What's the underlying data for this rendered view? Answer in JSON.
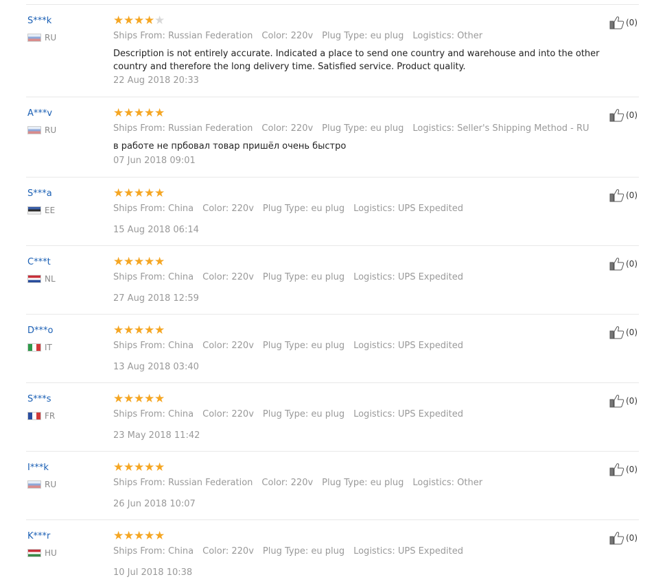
{
  "colors": {
    "star_on": "#f5a623",
    "star_off": "#d8d8d8",
    "user_link": "#1a5fb4"
  },
  "labels": {
    "ships_from": "Ships From:",
    "color": "Color:",
    "plug_type": "Plug Type:",
    "logistics": "Logistics:"
  },
  "reviews": [
    {
      "user": "S***k",
      "country": "RU",
      "flag": "ru",
      "rating": 4,
      "ships_from": "Russian Federation",
      "color": "220v",
      "plug": "eu plug",
      "logistics": "Other",
      "description": "Description is not entirely accurate. Indicated a place to send one country and warehouse and into the other country and therefore the long delivery time. Satisfied service. Product quality.",
      "date": "22 Aug 2018 20:33",
      "helpful": "(0)"
    },
    {
      "user": "A***v",
      "country": "RU",
      "flag": "ru",
      "rating": 5,
      "ships_from": "Russian Federation",
      "color": "220v",
      "plug": "eu plug",
      "logistics": "Seller's Shipping Method - RU",
      "description": "в работе не прбовал товар пришёл очень быстро",
      "date": "07 Jun 2018 09:01",
      "helpful": "(0)"
    },
    {
      "user": "S***a",
      "country": "EE",
      "flag": "ee",
      "rating": 5,
      "ships_from": "China",
      "color": "220v",
      "plug": "eu plug",
      "logistics": "UPS Expedited",
      "description": "",
      "date": "15 Aug 2018 06:14",
      "helpful": "(0)"
    },
    {
      "user": "C***t",
      "country": "NL",
      "flag": "nl",
      "rating": 5,
      "ships_from": "China",
      "color": "220v",
      "plug": "eu plug",
      "logistics": "UPS Expedited",
      "description": "",
      "date": "27 Aug 2018 12:59",
      "helpful": "(0)"
    },
    {
      "user": "D***o",
      "country": "IT",
      "flag": "it",
      "rating": 5,
      "ships_from": "China",
      "color": "220v",
      "plug": "eu plug",
      "logistics": "UPS Expedited",
      "description": "",
      "date": "13 Aug 2018 03:40",
      "helpful": "(0)"
    },
    {
      "user": "S***s",
      "country": "FR",
      "flag": "fr",
      "rating": 5,
      "ships_from": "China",
      "color": "220v",
      "plug": "eu plug",
      "logistics": "UPS Expedited",
      "description": "",
      "date": "23 May 2018 11:42",
      "helpful": "(0)"
    },
    {
      "user": "I***k",
      "country": "RU",
      "flag": "ru",
      "rating": 5,
      "ships_from": "Russian Federation",
      "color": "220v",
      "plug": "eu plug",
      "logistics": "Other",
      "description": "",
      "date": "26 Jun 2018 10:07",
      "helpful": "(0)"
    },
    {
      "user": "K***r",
      "country": "HU",
      "flag": "hu",
      "rating": 5,
      "ships_from": "China",
      "color": "220v",
      "plug": "eu plug",
      "logistics": "UPS Expedited",
      "description": "",
      "date": "10 Jul 2018 10:38",
      "helpful": "(0)"
    }
  ]
}
